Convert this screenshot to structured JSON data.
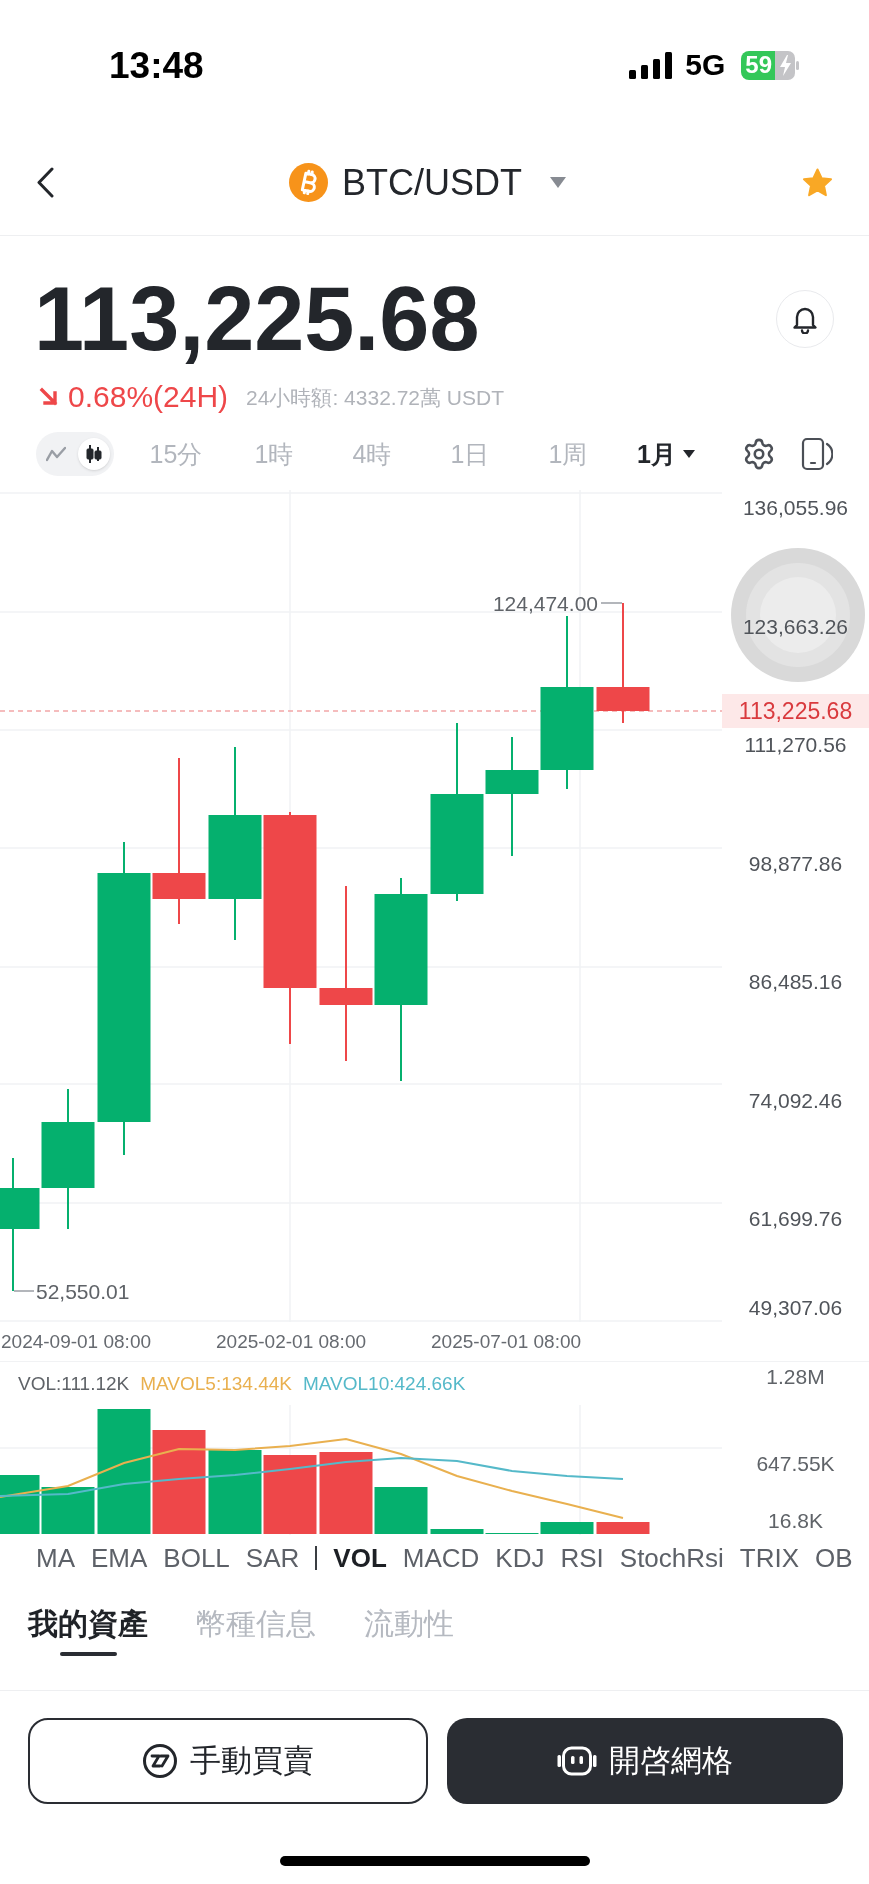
{
  "status_bar": {
    "time": "13:48",
    "network": "5G",
    "battery": "59"
  },
  "header": {
    "pair": "BTC/USDT",
    "favorite": true
  },
  "ticker": {
    "price": "113,225.68",
    "falling": true,
    "change": "0.68%(24H)",
    "volume_24h": "24小時額: 4332.72萬 USDT"
  },
  "chart_types": [
    {
      "kind": "line",
      "selected": false
    },
    {
      "kind": "candlestick",
      "selected": true
    }
  ],
  "intervals": [
    {
      "label": "15分",
      "selected": false
    },
    {
      "label": "1時",
      "selected": false
    },
    {
      "label": "4時",
      "selected": false
    },
    {
      "label": "1日",
      "selected": false
    },
    {
      "label": "1周",
      "selected": false
    },
    {
      "label": "1月",
      "selected": true
    }
  ],
  "price_chart": {
    "y_axis": [
      "136,055.96",
      "123,663.26",
      "111,270.56",
      "98,877.86",
      "86,485.16",
      "74,092.46",
      "61,699.76",
      "49,307.06"
    ],
    "x_axis": [
      "2024-09-01 08:00",
      "2025-02-01 08:00",
      "2025-07-01 08:00"
    ],
    "high_marker": "124,474.00",
    "low_marker": "52,550.01",
    "last_price_tag": "113,225.68"
  },
  "volume_chart": {
    "legend": [
      {
        "text": "VOL:111.12K",
        "color": "#5f6368"
      },
      {
        "text": "MAVOL5:134.44K",
        "color": "#e9b04f"
      },
      {
        "text": "MAVOL10:424.66K",
        "color": "#55b9c9"
      }
    ],
    "y_axis": [
      "1.28M",
      "647.55K",
      "16.8K"
    ]
  },
  "main_indicators": [
    {
      "label": "MA",
      "selected": false
    },
    {
      "label": "EMA",
      "selected": false
    },
    {
      "label": "BOLL",
      "selected": false
    },
    {
      "label": "SAR",
      "selected": false
    }
  ],
  "sub_indicators": [
    {
      "label": "VOL",
      "selected": true
    },
    {
      "label": "MACD",
      "selected": false
    },
    {
      "label": "KDJ",
      "selected": false
    },
    {
      "label": "RSI",
      "selected": false
    },
    {
      "label": "StochRsi",
      "selected": false
    },
    {
      "label": "TRIX",
      "selected": false
    },
    {
      "label": "OB",
      "selected": false
    }
  ],
  "tabs": [
    {
      "label": "我的資產",
      "selected": true
    },
    {
      "label": "幣種信息",
      "selected": false
    },
    {
      "label": "流動性",
      "selected": false
    }
  ],
  "actions": [
    {
      "kind": "outline",
      "label": "手動買賣"
    },
    {
      "kind": "filled",
      "label": "開啓網格"
    }
  ]
}
